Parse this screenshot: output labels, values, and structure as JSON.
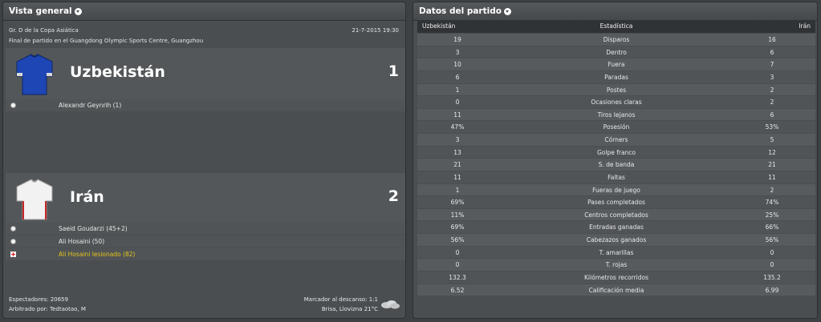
{
  "overview": {
    "title": "Vista general",
    "competition": "Gr. D de la Copa Asiática",
    "date": "21-7-2015 19:30",
    "venue": "Final de partido en el Guangdong Olympic Sports Centre, Guangzhou",
    "home": {
      "name": "Uzbekistán",
      "score": "1",
      "shirt_color": "#1e46b4",
      "events": [
        {
          "icon": "ball-icon",
          "text": "Alexandr Geynrih (1)"
        }
      ]
    },
    "away": {
      "name": "Irán",
      "score": "2",
      "shirt_color": "#f2f2f2",
      "events": [
        {
          "icon": "ball-icon",
          "text": "Saeid Goudarzi (45+2)"
        },
        {
          "icon": "ball-icon",
          "text": "Ali Hosaini (50)"
        },
        {
          "icon": "injury-icon",
          "text": "Ali Hosaini lesionado (82)"
        }
      ]
    },
    "footer": {
      "attendance": "Espectadores: 20659",
      "referee": "Arbitrado por: Tedtaotao, M",
      "halftime": "Marcador al descanso: 1:1",
      "weather": "Brisa, Llovizna 21°C",
      "weather_icon": "cloud-icon"
    }
  },
  "stats": {
    "title": "Datos del partido",
    "head_home": "Uzbekistán",
    "head_label": "Estadística",
    "head_away": "Irán",
    "rows": [
      {
        "home": "19",
        "label": "Disparos",
        "away": "16"
      },
      {
        "home": "3",
        "label": "Dentro",
        "away": "6"
      },
      {
        "home": "10",
        "label": "Fuera",
        "away": "7"
      },
      {
        "home": "6",
        "label": "Paradas",
        "away": "3"
      },
      {
        "home": "1",
        "label": "Postes",
        "away": "2"
      },
      {
        "home": "0",
        "label": "Ocasiones claras",
        "away": "2"
      },
      {
        "home": "11",
        "label": "Tiros lejanos",
        "away": "6"
      },
      {
        "home": "47%",
        "label": "Posesión",
        "away": "53%"
      },
      {
        "home": "3",
        "label": "Córners",
        "away": "5"
      },
      {
        "home": "13",
        "label": "Golpe franco",
        "away": "12"
      },
      {
        "home": "21",
        "label": "S. de banda",
        "away": "21"
      },
      {
        "home": "11",
        "label": "Faltas",
        "away": "11"
      },
      {
        "home": "1",
        "label": "Fueras de juego",
        "away": "2"
      },
      {
        "home": "69%",
        "label": "Pases completados",
        "away": "74%"
      },
      {
        "home": "11%",
        "label": "Centros completados",
        "away": "25%"
      },
      {
        "home": "69%",
        "label": "Entradas ganadas",
        "away": "66%"
      },
      {
        "home": "56%",
        "label": "Cabezazos ganados",
        "away": "56%"
      },
      {
        "home": "0",
        "label": "T. amarillas",
        "away": "0"
      },
      {
        "home": "0",
        "label": "T. rojas",
        "away": "0"
      },
      {
        "home": "132.3",
        "label": "Kilómetros recorridos",
        "away": "135.2"
      },
      {
        "home": "6.52",
        "label": "Calificación media",
        "away": "6.99"
      }
    ]
  }
}
